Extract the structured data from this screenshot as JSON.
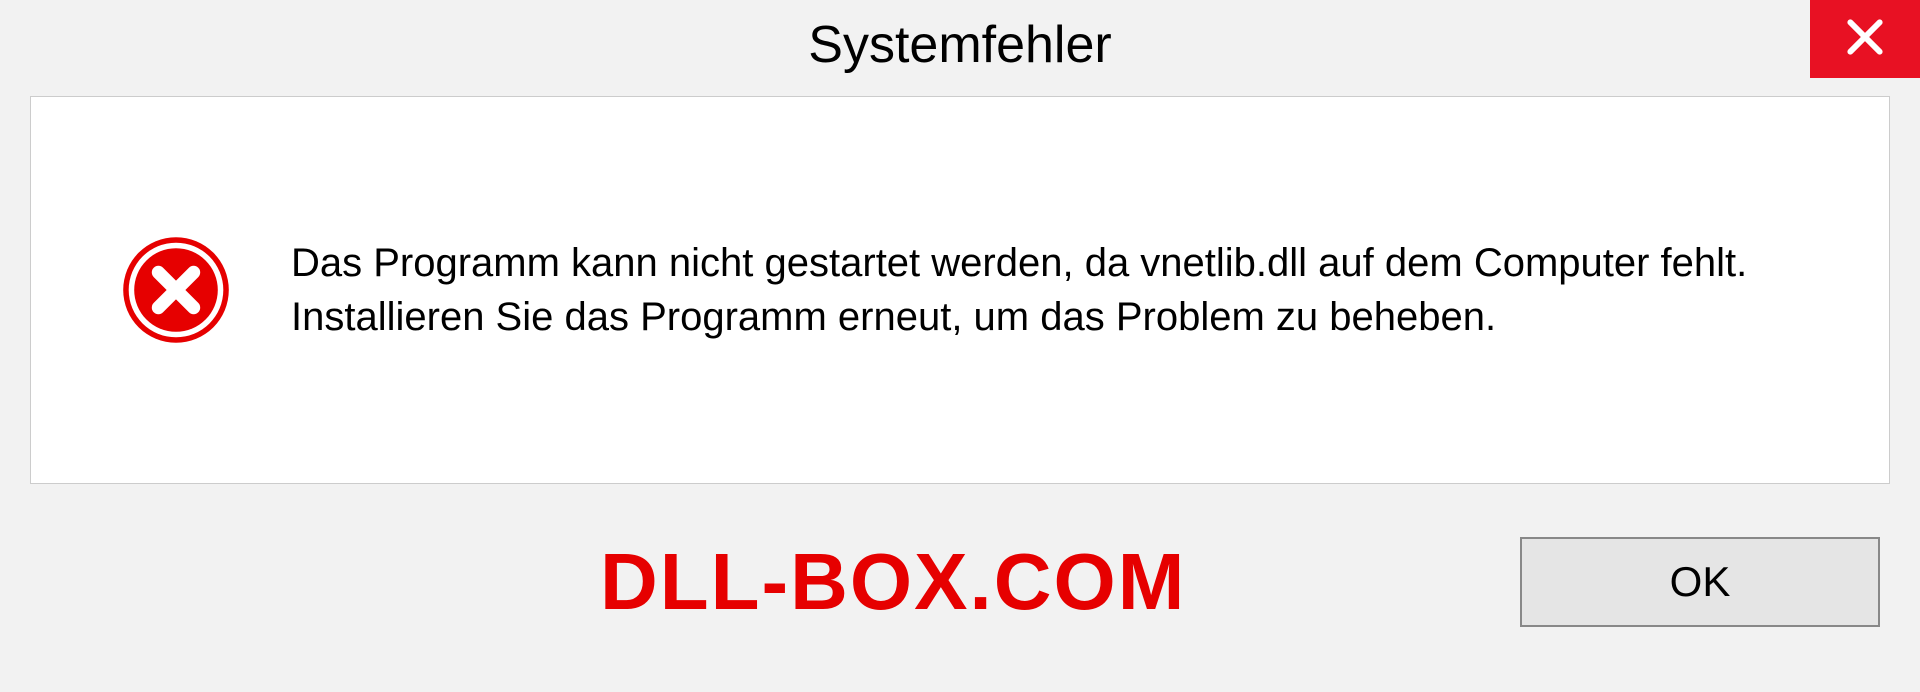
{
  "titlebar": {
    "title": "Systemfehler"
  },
  "dialog": {
    "message": "Das Programm kann nicht gestartet werden, da vnetlib.dll auf dem Computer fehlt. Installieren Sie das Programm erneut, um das Problem zu beheben."
  },
  "footer": {
    "watermark": "DLL-BOX.COM",
    "ok_label": "OK"
  }
}
